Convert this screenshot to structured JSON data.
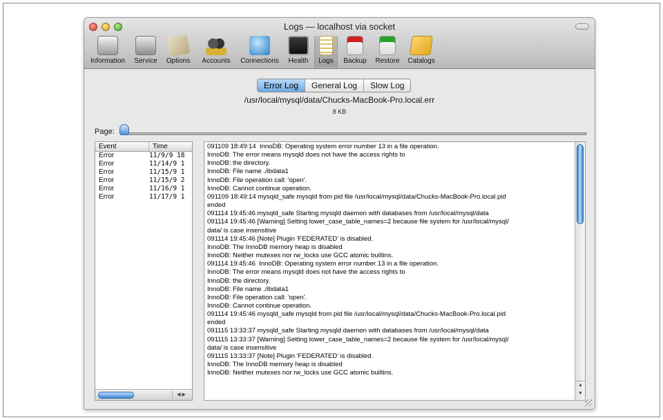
{
  "window": {
    "title": "Logs — localhost via socket"
  },
  "toolbar": {
    "items": [
      {
        "label": "Information",
        "icon": "information-icon"
      },
      {
        "label": "Service",
        "icon": "service-icon"
      },
      {
        "label": "Options",
        "icon": "options-icon"
      },
      {
        "label": "Accounts",
        "icon": "accounts-icon"
      },
      {
        "label": "Connections",
        "icon": "connections-icon"
      },
      {
        "label": "Health",
        "icon": "health-icon"
      },
      {
        "label": "Logs",
        "icon": "logs-icon",
        "active": true
      },
      {
        "label": "Backup",
        "icon": "backup-icon"
      },
      {
        "label": "Restore",
        "icon": "restore-icon"
      },
      {
        "label": "Catalogs",
        "icon": "catalogs-icon"
      }
    ]
  },
  "tabs": {
    "items": [
      "Error Log",
      "General Log",
      "Slow Log"
    ],
    "selected": "Error Log"
  },
  "file": {
    "path": "/usr/local/mysql/data/Chucks-MacBook-Pro.local.err",
    "size": "8 KB"
  },
  "pager": {
    "label": "Page:"
  },
  "events": {
    "headers": {
      "event": "Event",
      "time": "Time"
    },
    "rows": [
      {
        "event": "Error",
        "time": "11/9/9 18"
      },
      {
        "event": "Error",
        "time": "11/14/9 1"
      },
      {
        "event": "Error",
        "time": "11/15/9 1"
      },
      {
        "event": "Error",
        "time": "11/15/9 2"
      },
      {
        "event": "Error",
        "time": "11/16/9 1"
      },
      {
        "event": "Error",
        "time": "11/17/9 1"
      }
    ]
  },
  "log": {
    "text": "091109 18:49:14  InnoDB: Operating system error number 13 in a file operation.\nInnoDB: The error means mysqld does not have the access rights to\nInnoDB: the directory.\nInnoDB: File name ./ibdata1\nInnoDB: File operation call: 'open'.\nInnoDB: Cannot continue operation.\n091109 18:49:14 mysqld_safe mysqld from pid file /usr/local/mysql/data/Chucks-MacBook-Pro.local.pid\nended\n091114 19:45:46 mysqld_safe Starting mysqld daemon with databases from /usr/local/mysql/data\n091114 19:45:46 [Warning] Setting lower_case_table_names=2 because file system for /usr/local/mysql/\ndata/ is case insensitive\n091114 19:45:46 [Note] Plugin 'FEDERATED' is disabled.\nInnoDB: The InnoDB memory heap is disabled\nInnoDB: Neither mutexes nor rw_locks use GCC atomic builtins.\n091114 19:45:46  InnoDB: Operating system error number 13 in a file operation.\nInnoDB: The error means mysqld does not have the access rights to\nInnoDB: the directory.\nInnoDB: File name ./ibdata1\nInnoDB: File operation call: 'open'.\nInnoDB: Cannot continue operation.\n091114 19:45:46 mysqld_safe mysqld from pid file /usr/local/mysql/data/Chucks-MacBook-Pro.local.pid\nended\n091115 13:33:37 mysqld_safe Starting mysqld daemon with databases from /usr/local/mysql/data\n091115 13:33:37 [Warning] Setting lower_case_table_names=2 because file system for /usr/local/mysql/\ndata/ is case insensitive\n091115 13:33:37 [Note] Plugin 'FEDERATED' is disabled.\nInnoDB: The InnoDB memory heap is disabled\nInnoDB: Neither mutexes nor rw_locks use GCC atomic builtins."
  },
  "colors": {
    "accent": "#4a8fd3",
    "selected_tab": "#8fbdec"
  }
}
